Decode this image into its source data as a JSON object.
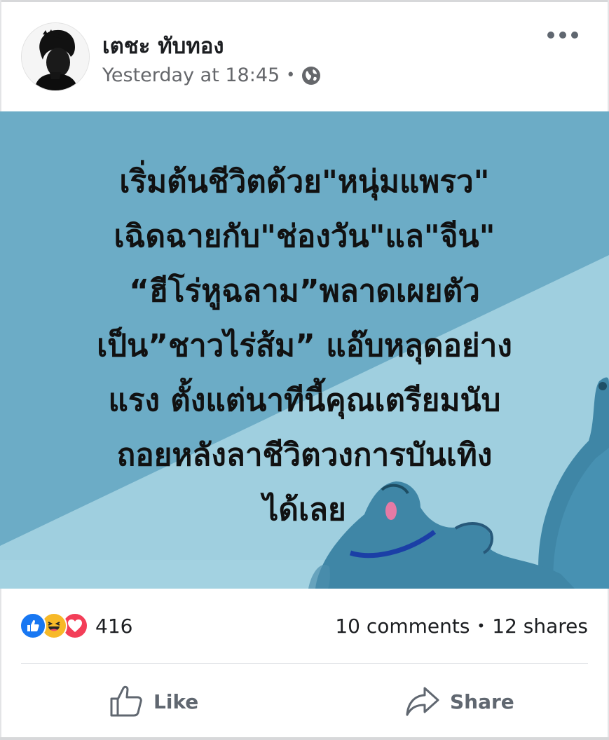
{
  "post": {
    "author": "เตชะ ทับทอง",
    "timestamp": "Yesterday at 18:45",
    "separator": "•",
    "privacy_icon": "globe-icon",
    "more_icon": "more-options-icon",
    "image_text": [
      "เริ่มต้นชีวิตด้วย\"หนุ่มแพรว\"",
      "เฉิดฉายกับ\"ช่องวัน\"แล\"จีน\"",
      "“ฮีโร่หูฉลาม”พลาดเผยตัว",
      "เป็น”ชาวไร่ส้ม” แอ๊บหลุดอย่าง",
      "แรง ตั้งแต่นาทีนี้คุณเตรียมนับ",
      "ถอยหลังลาชีวิตวงการบันเทิง",
      "ได้เลย"
    ]
  },
  "stats": {
    "reactions": [
      "like",
      "haha",
      "love"
    ],
    "reaction_count": "416",
    "comments": "10 comments",
    "separator": "•",
    "shares": "12 shares"
  },
  "actions": {
    "like_label": "Like",
    "share_label": "Share"
  },
  "colors": {
    "image_bg": "#6cacc6",
    "image_light": "#9fcfdf",
    "like_blue": "#1877f2",
    "haha_yellow": "#f7b928",
    "love_red": "#f33e58",
    "action_gray": "#606770"
  }
}
